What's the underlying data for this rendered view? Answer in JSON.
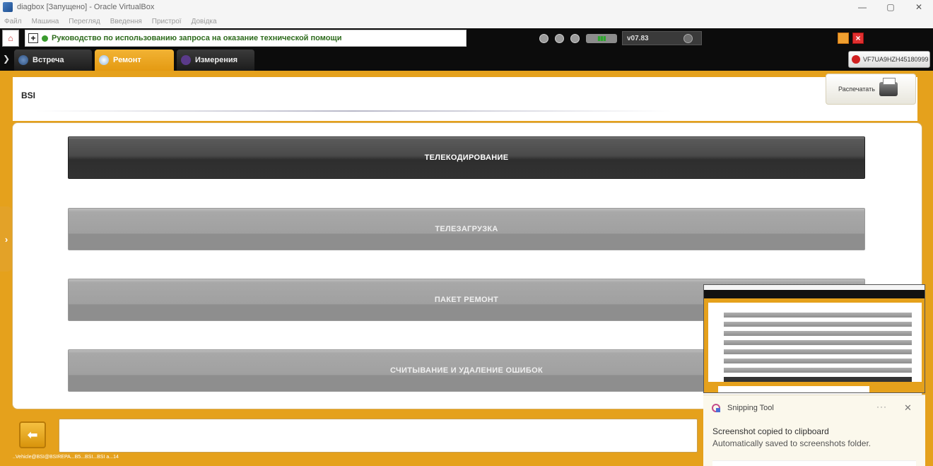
{
  "window": {
    "title": "diagbox [Запущено] - Oracle VirtualBox",
    "controls": {
      "minimize": "—",
      "maximize": "▢",
      "close": "✕"
    }
  },
  "menubar": {
    "items": [
      "Файл",
      "Машина",
      "Перегляд",
      "Введення",
      "Пристрої",
      "Довідка"
    ]
  },
  "header": {
    "message": "Руководство по использованию запроса на оказание технической помощи",
    "version": "v07.83",
    "icons": [
      "download-icon",
      "user-icon",
      "globe-icon",
      "battery-icon",
      "settings-knob-icon"
    ]
  },
  "tabs": [
    {
      "label": "Встреча",
      "icon": "meeting-icon",
      "active": false
    },
    {
      "label": "Ремонт",
      "icon": "repair-icon",
      "active": true
    },
    {
      "label": "Измерения",
      "icon": "measure-icon",
      "active": false
    }
  ],
  "vin": "VF7UA9HZH45180999",
  "page": {
    "title": "BSI",
    "print_label": "Распечатать"
  },
  "menu_buttons": [
    {
      "label": "ТЕЛЕКОДИРОВАНИЕ",
      "active": true
    },
    {
      "label": "ТЕЛЕЗАГРУЗКА",
      "active": false
    },
    {
      "label": "ПАКЕТ РЕМОНТ",
      "active": false
    },
    {
      "label": "СЧИТЫВАНИЕ И УДАЛЕНИЕ ОШИБОК",
      "active": false
    }
  ],
  "footer": {
    "path": "..Vehicle@BSI@BSIREPA...B5...BSI...BSI a...14"
  },
  "snipping_tool": {
    "app_name": "Snipping Tool",
    "more": "···",
    "close": "✕",
    "line1": "Screenshot copied to clipboard",
    "line2": "Automatically saved to screenshots folder."
  },
  "colors": {
    "accent": "#e5a11c",
    "header_bg": "#0c0c0c",
    "active_button": "#3a3a3a",
    "normal_button": "#a0a0a0"
  }
}
